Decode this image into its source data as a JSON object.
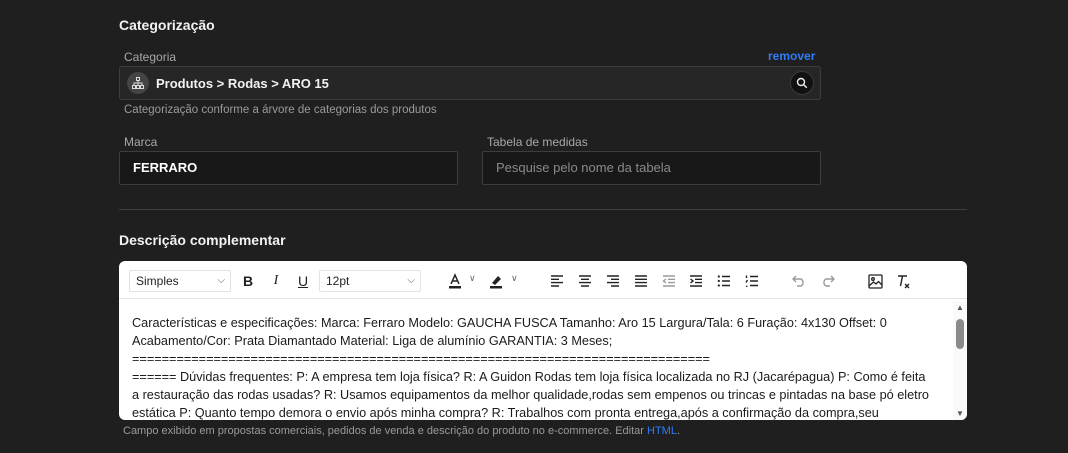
{
  "categorization": {
    "title": "Categorização",
    "category_label": "Categoria",
    "remove_label": "remover",
    "category_value": "Produtos > Rodas > ARO 15",
    "help_text": "Categorização conforme a árvore de categorias dos produtos",
    "brand_label": "Marca",
    "brand_value": "FERRARO",
    "size_table_label": "Tabela de medidas",
    "size_table_placeholder": "Pesquise pelo nome da tabela"
  },
  "description": {
    "title": "Descrição complementar",
    "toolbar": {
      "format_select": "Simples",
      "font_size_select": "12pt"
    },
    "content": "Características e especificações: Marca: Ferraro Modelo: GAUCHA FUSCA Tamanho: Aro 15 Largura/Tala: 6 Furação: 4x130 Offset: 0\nAcabamento/Cor: Prata Diamantado Material: Liga de alumínio GARANTIA: 3 Meses;\n==============================================================================\n====== Dúvidas frequentes: P: A empresa tem loja física? R: A Guidon Rodas tem loja física localizada no RJ (Jacarépagua) P: Como é feita a restauração das rodas usadas? R: Usamos equipamentos da melhor qualidade,rodas sem empenos ou trincas e pintadas na base pó eletroestática P: Quanto tempo demora o envio após minha compra? R: Trabalhos com pronta entrega,após a confirmação da compra,seu",
    "footer_text": "Campo exibido em propostas comerciais, pedidos de venda e descrição do produto no e-commerce. Editar ",
    "footer_link": "HTML",
    "footer_end": "."
  },
  "colors": {
    "background": "#1f1f1f",
    "accent": "#2f7cf6",
    "editor_bg": "#ffffff"
  }
}
